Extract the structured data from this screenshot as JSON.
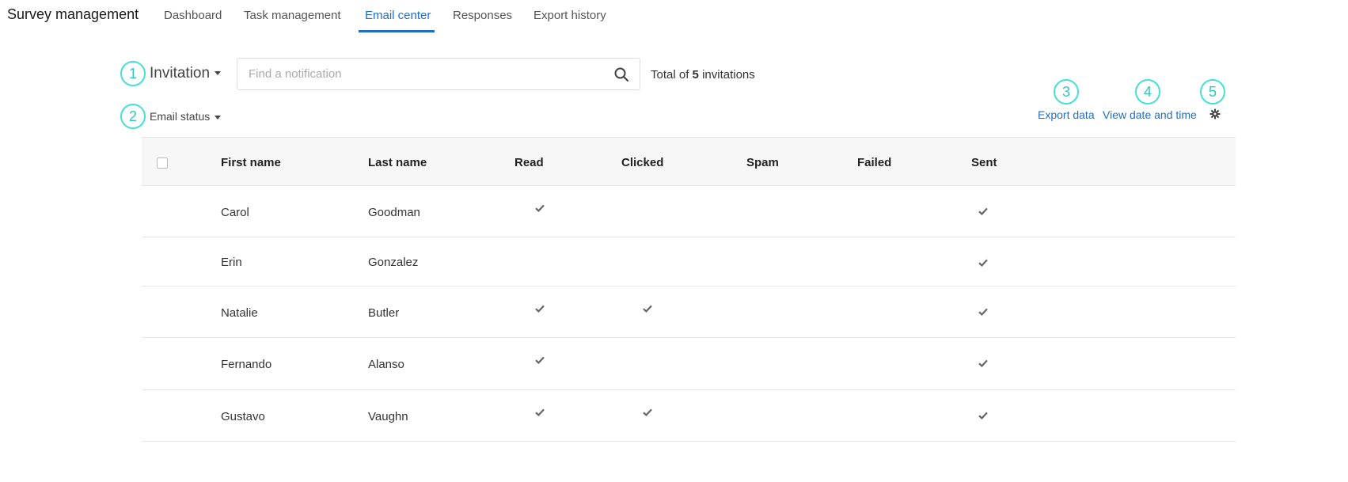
{
  "app": {
    "title": "Survey management"
  },
  "nav": {
    "tabs": [
      {
        "label": "Dashboard"
      },
      {
        "label": "Task management"
      },
      {
        "label": "Email center",
        "active": true
      },
      {
        "label": "Responses"
      },
      {
        "label": "Export history"
      }
    ]
  },
  "callouts": [
    "1",
    "2",
    "3",
    "4",
    "5"
  ],
  "toolbar": {
    "type_selected": "Invitation",
    "search_placeholder": "Find a notification",
    "search_value": "",
    "total_prefix": "Total of",
    "total_count": "5",
    "total_suffix": "invitations",
    "status_filter": "Email status",
    "export_label": "Export data",
    "view_date_label": "View date and time"
  },
  "table": {
    "headers": [
      "First name",
      "Last name",
      "Read",
      "Clicked",
      "Spam",
      "Failed",
      "Sent"
    ],
    "rows": [
      {
        "first": "Carol",
        "last": "Goodman",
        "read": true,
        "clicked": false,
        "spam": false,
        "failed": false,
        "sent": true
      },
      {
        "first": "Erin",
        "last": "Gonzalez",
        "read": false,
        "clicked": false,
        "spam": false,
        "failed": false,
        "sent": true
      },
      {
        "first": "Natalie",
        "last": "Butler",
        "read": true,
        "clicked": true,
        "spam": false,
        "failed": false,
        "sent": true
      },
      {
        "first": "Fernando",
        "last": "Alanso",
        "read": true,
        "clicked": false,
        "spam": false,
        "failed": false,
        "sent": true
      },
      {
        "first": "Gustavo",
        "last": "Vaughn",
        "read": true,
        "clicked": true,
        "spam": false,
        "failed": false,
        "sent": true
      }
    ]
  },
  "colors": {
    "accent": "#1f6fc5",
    "callout": "#45e0d4",
    "check": "#666666"
  }
}
